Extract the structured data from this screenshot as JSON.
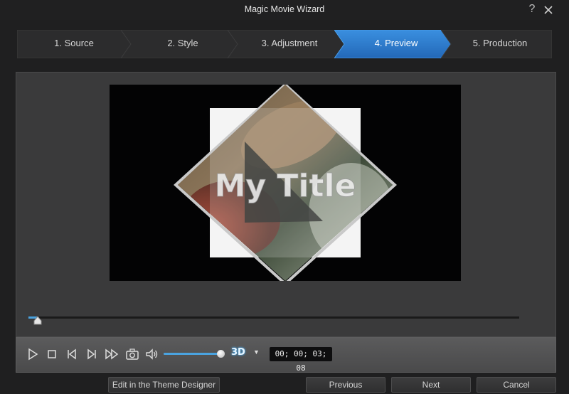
{
  "window": {
    "title": "Magic Movie Wizard",
    "help_glyph": "?",
    "close_icon": "close-icon"
  },
  "steps": [
    {
      "label": "1. Source",
      "active": false
    },
    {
      "label": "2. Style",
      "active": false
    },
    {
      "label": "3. Adjustment",
      "active": false
    },
    {
      "label": "4. Preview",
      "active": true
    },
    {
      "label": "5. Production",
      "active": false
    }
  ],
  "preview": {
    "overlay_text": "My Title"
  },
  "playback": {
    "timeline_progress": 0.02,
    "volume_level": 0.95,
    "three_d_label": "3D",
    "three_d_dropdown_glyph": "▼",
    "timecode": "00; 00; 03; 08"
  },
  "buttons": {
    "theme_designer": "Edit in the Theme Designer",
    "previous": "Previous",
    "next": "Next",
    "cancel": "Cancel"
  },
  "colors": {
    "accent": "#4aa3e0",
    "active_step": "#2f7fd0",
    "background": "#1f1f20"
  }
}
